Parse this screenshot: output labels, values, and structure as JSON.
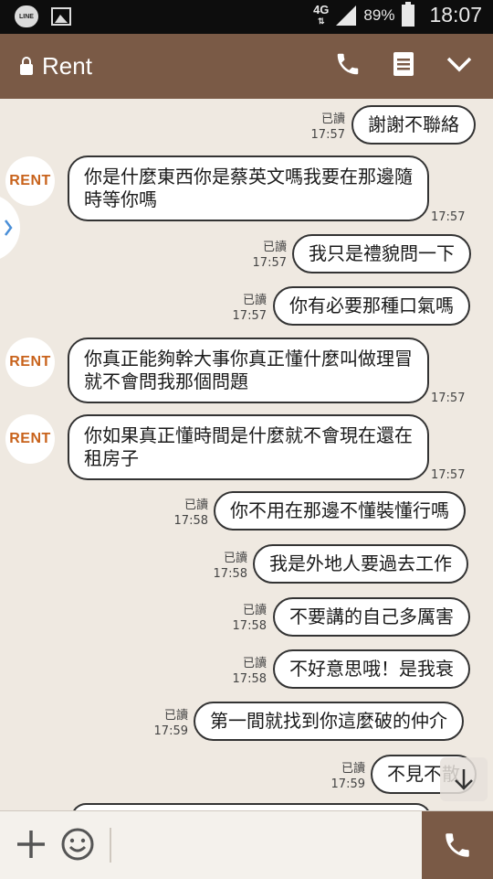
{
  "status_bar": {
    "network": "4G",
    "battery": "89%",
    "time": "18:07",
    "line_icon": "LINE"
  },
  "header": {
    "title": "Rent",
    "icons": [
      "lock-icon",
      "phone-icon",
      "notes-icon",
      "chevron-down-icon"
    ]
  },
  "colors": {
    "header_bg": "#7a5a46",
    "chat_bg": "#efe9e1",
    "avatar_text": "#c8621b"
  },
  "avatar_text": "RENT",
  "messages": [
    {
      "dir": "out",
      "text": "謝謝不聯絡",
      "read": "已讀",
      "time": "17:57"
    },
    {
      "dir": "in",
      "text": "你是什麼東西你是蔡英文嗎我要在那邊隨時等你嗎",
      "time": "17:57"
    },
    {
      "dir": "out",
      "text": "我只是禮貌問一下",
      "read": "已讀",
      "time": "17:57"
    },
    {
      "dir": "out",
      "text": "你有必要那種口氣嗎",
      "read": "已讀",
      "time": "17:57"
    },
    {
      "dir": "in",
      "text": "你真正能夠幹大事你真正懂什麼叫做理冒就不會問我那個問題",
      "time": "17:57"
    },
    {
      "dir": "in",
      "text": "你如果真正懂時間是什麼就不會現在還在租房子",
      "time": "17:57"
    },
    {
      "dir": "out",
      "text": "你不用在那邊不懂裝懂行嗎",
      "read": "已讀",
      "time": "17:58"
    },
    {
      "dir": "out",
      "text": "我是外地人要過去工作",
      "read": "已讀",
      "time": "17:58"
    },
    {
      "dir": "out",
      "text": "不要講的自己多厲害",
      "read": "已讀",
      "time": "17:58"
    },
    {
      "dir": "out",
      "text": "不好意思哦！是我衰",
      "read": "已讀",
      "time": "17:58"
    },
    {
      "dir": "out",
      "text": "第一間就找到你這麼破的仲介",
      "read": "已讀",
      "time": "17:59"
    },
    {
      "dir": "out",
      "text": "不見不散",
      "read": "已讀",
      "time": "17:59"
    }
  ]
}
